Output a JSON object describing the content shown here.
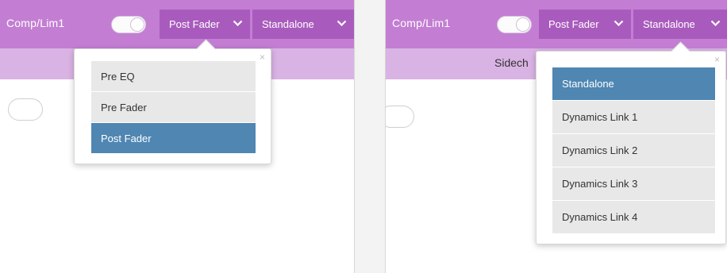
{
  "left": {
    "title": "Comp/Lim1",
    "placement_button": "Post Fader",
    "link_button": "Standalone",
    "placement_options": [
      "Pre EQ",
      "Pre Fader",
      "Post Fader"
    ],
    "selected_option": "Post Fader",
    "close": "×"
  },
  "right": {
    "title": "Comp/Lim1",
    "placement_button": "Post Fader",
    "link_button": "Standalone",
    "subbar_label": "Sidech",
    "link_options": [
      "Standalone",
      "Dynamics Link 1",
      "Dynamics Link 2",
      "Dynamics Link 3",
      "Dynamics Link 4"
    ],
    "selected_option": "Standalone",
    "close": "×"
  },
  "colors": {
    "header": "#c37ed3",
    "header_button": "#a95bbd",
    "subbar": "#d9b3e3",
    "selected": "#4f86b2"
  },
  "icons": {
    "chevron": "chevron-down-icon",
    "close": "close-icon",
    "arrow": "popup-arrow"
  }
}
